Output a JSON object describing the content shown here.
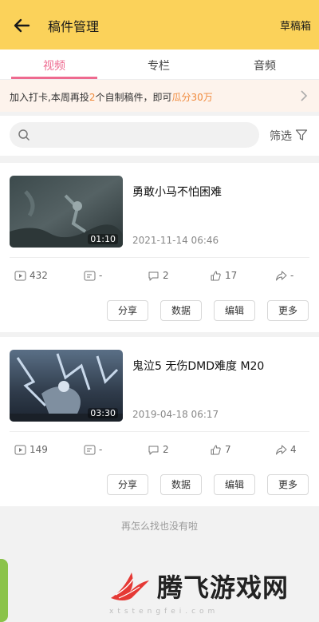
{
  "header": {
    "title": "稿件管理",
    "drafts_label": "草稿箱"
  },
  "tabs": [
    "视频",
    "专栏",
    "音频"
  ],
  "banner": {
    "prefix": "加入打卡,本周再投",
    "count": "2",
    "middle": "个自制稿件，即可",
    "reward": "瓜分30万"
  },
  "search": {
    "placeholder": "",
    "filter_label": "筛选"
  },
  "videos": [
    {
      "title": "勇敢小马不怕困难",
      "date": "2021-11-14 06:46",
      "duration": "01:10",
      "plays": "432",
      "danmaku": "-",
      "comments": "2",
      "likes": "17",
      "shares": "-"
    },
    {
      "title": "鬼泣5 无伤DMD难度 M20",
      "date": "2019-04-18 06:17",
      "duration": "03:30",
      "plays": "149",
      "danmaku": "-",
      "comments": "2",
      "likes": "7",
      "shares": "4"
    }
  ],
  "actions": [
    "分享",
    "数据",
    "编辑",
    "更多"
  ],
  "end_text": "再怎么找也没有啦",
  "watermark": {
    "name": "腾飞游戏网",
    "url": "xtstengfei.com"
  },
  "colors": {
    "header": "#fbd25a",
    "accent": "#ee6a8f",
    "highlight": "#f08a3c"
  }
}
